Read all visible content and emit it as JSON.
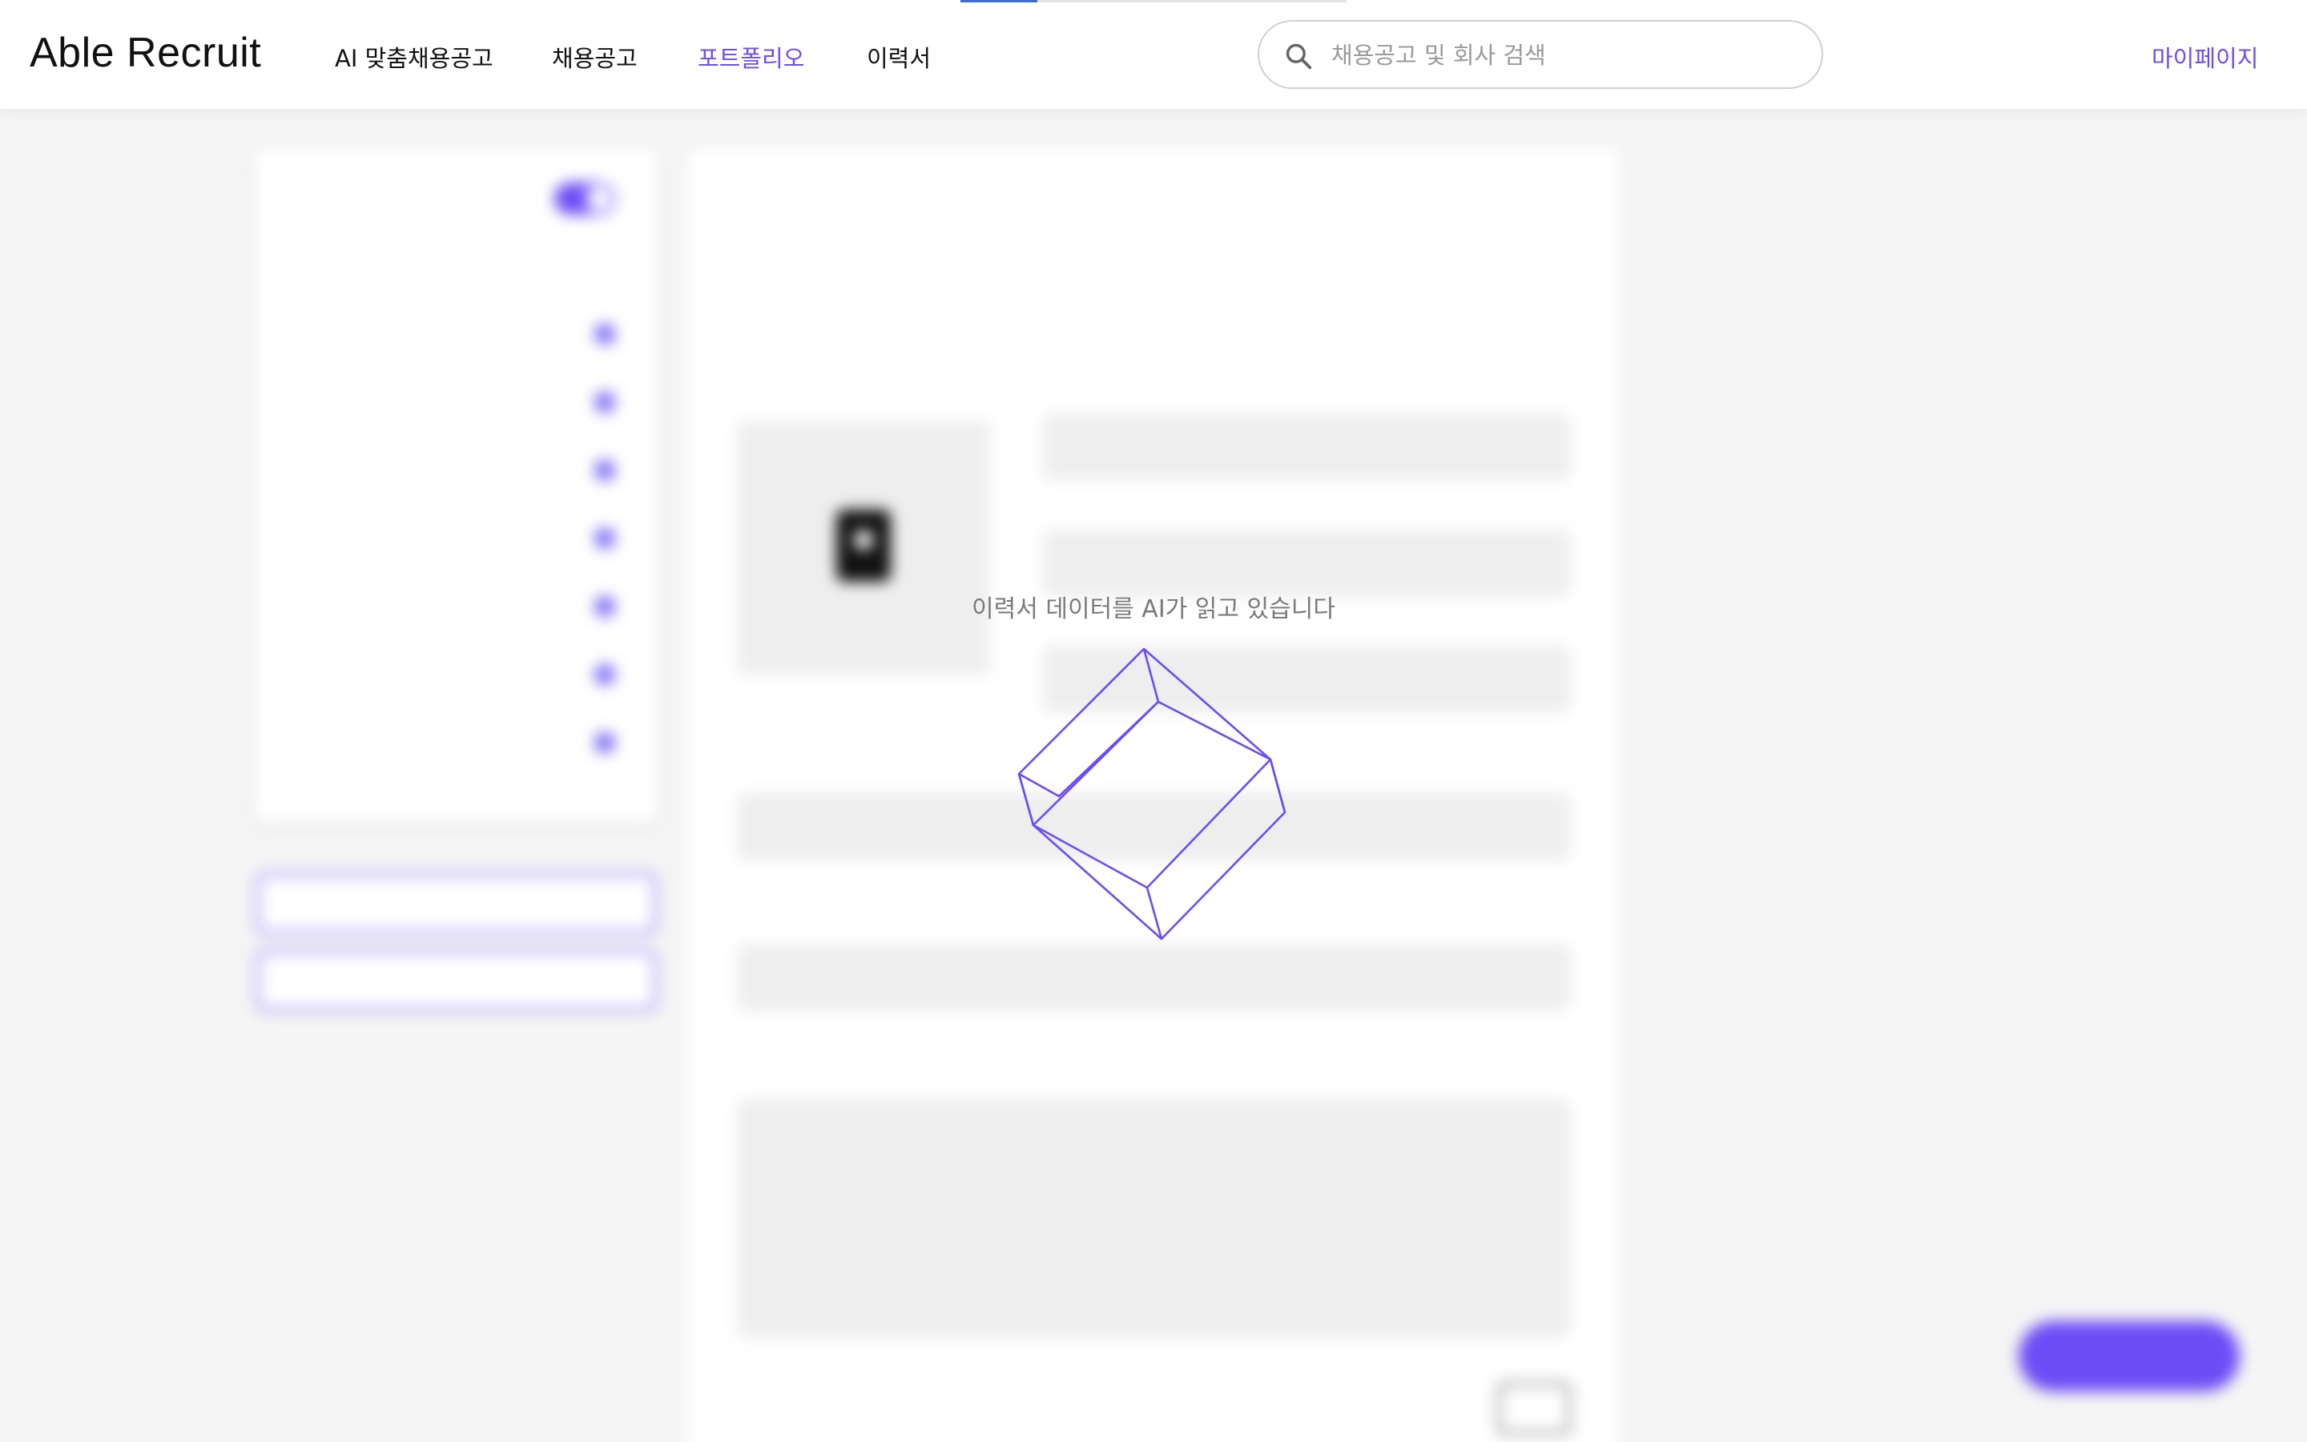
{
  "header": {
    "logo": "Able Recruit",
    "nav": [
      {
        "label": "AI 맞춤채용공고",
        "active": false
      },
      {
        "label": "채용공고",
        "active": false
      },
      {
        "label": "포트폴리오",
        "active": true
      },
      {
        "label": "이력서",
        "active": false
      }
    ],
    "search_placeholder": "채용공고 및 회사 검색",
    "mypage": "마이페이지"
  },
  "loading": {
    "text": "이력서 데이터를 AI가 읽고 있습니다"
  },
  "icons": {
    "search": "search-icon",
    "loading": "cube-spinner-icon",
    "profile": "profile-photo-icon",
    "chat": "chat-icon"
  },
  "colors": {
    "accent": "#6c4cf5",
    "loading_stroke": "#6c4cf5",
    "text": "#111111",
    "muted": "#7a7a7a"
  }
}
